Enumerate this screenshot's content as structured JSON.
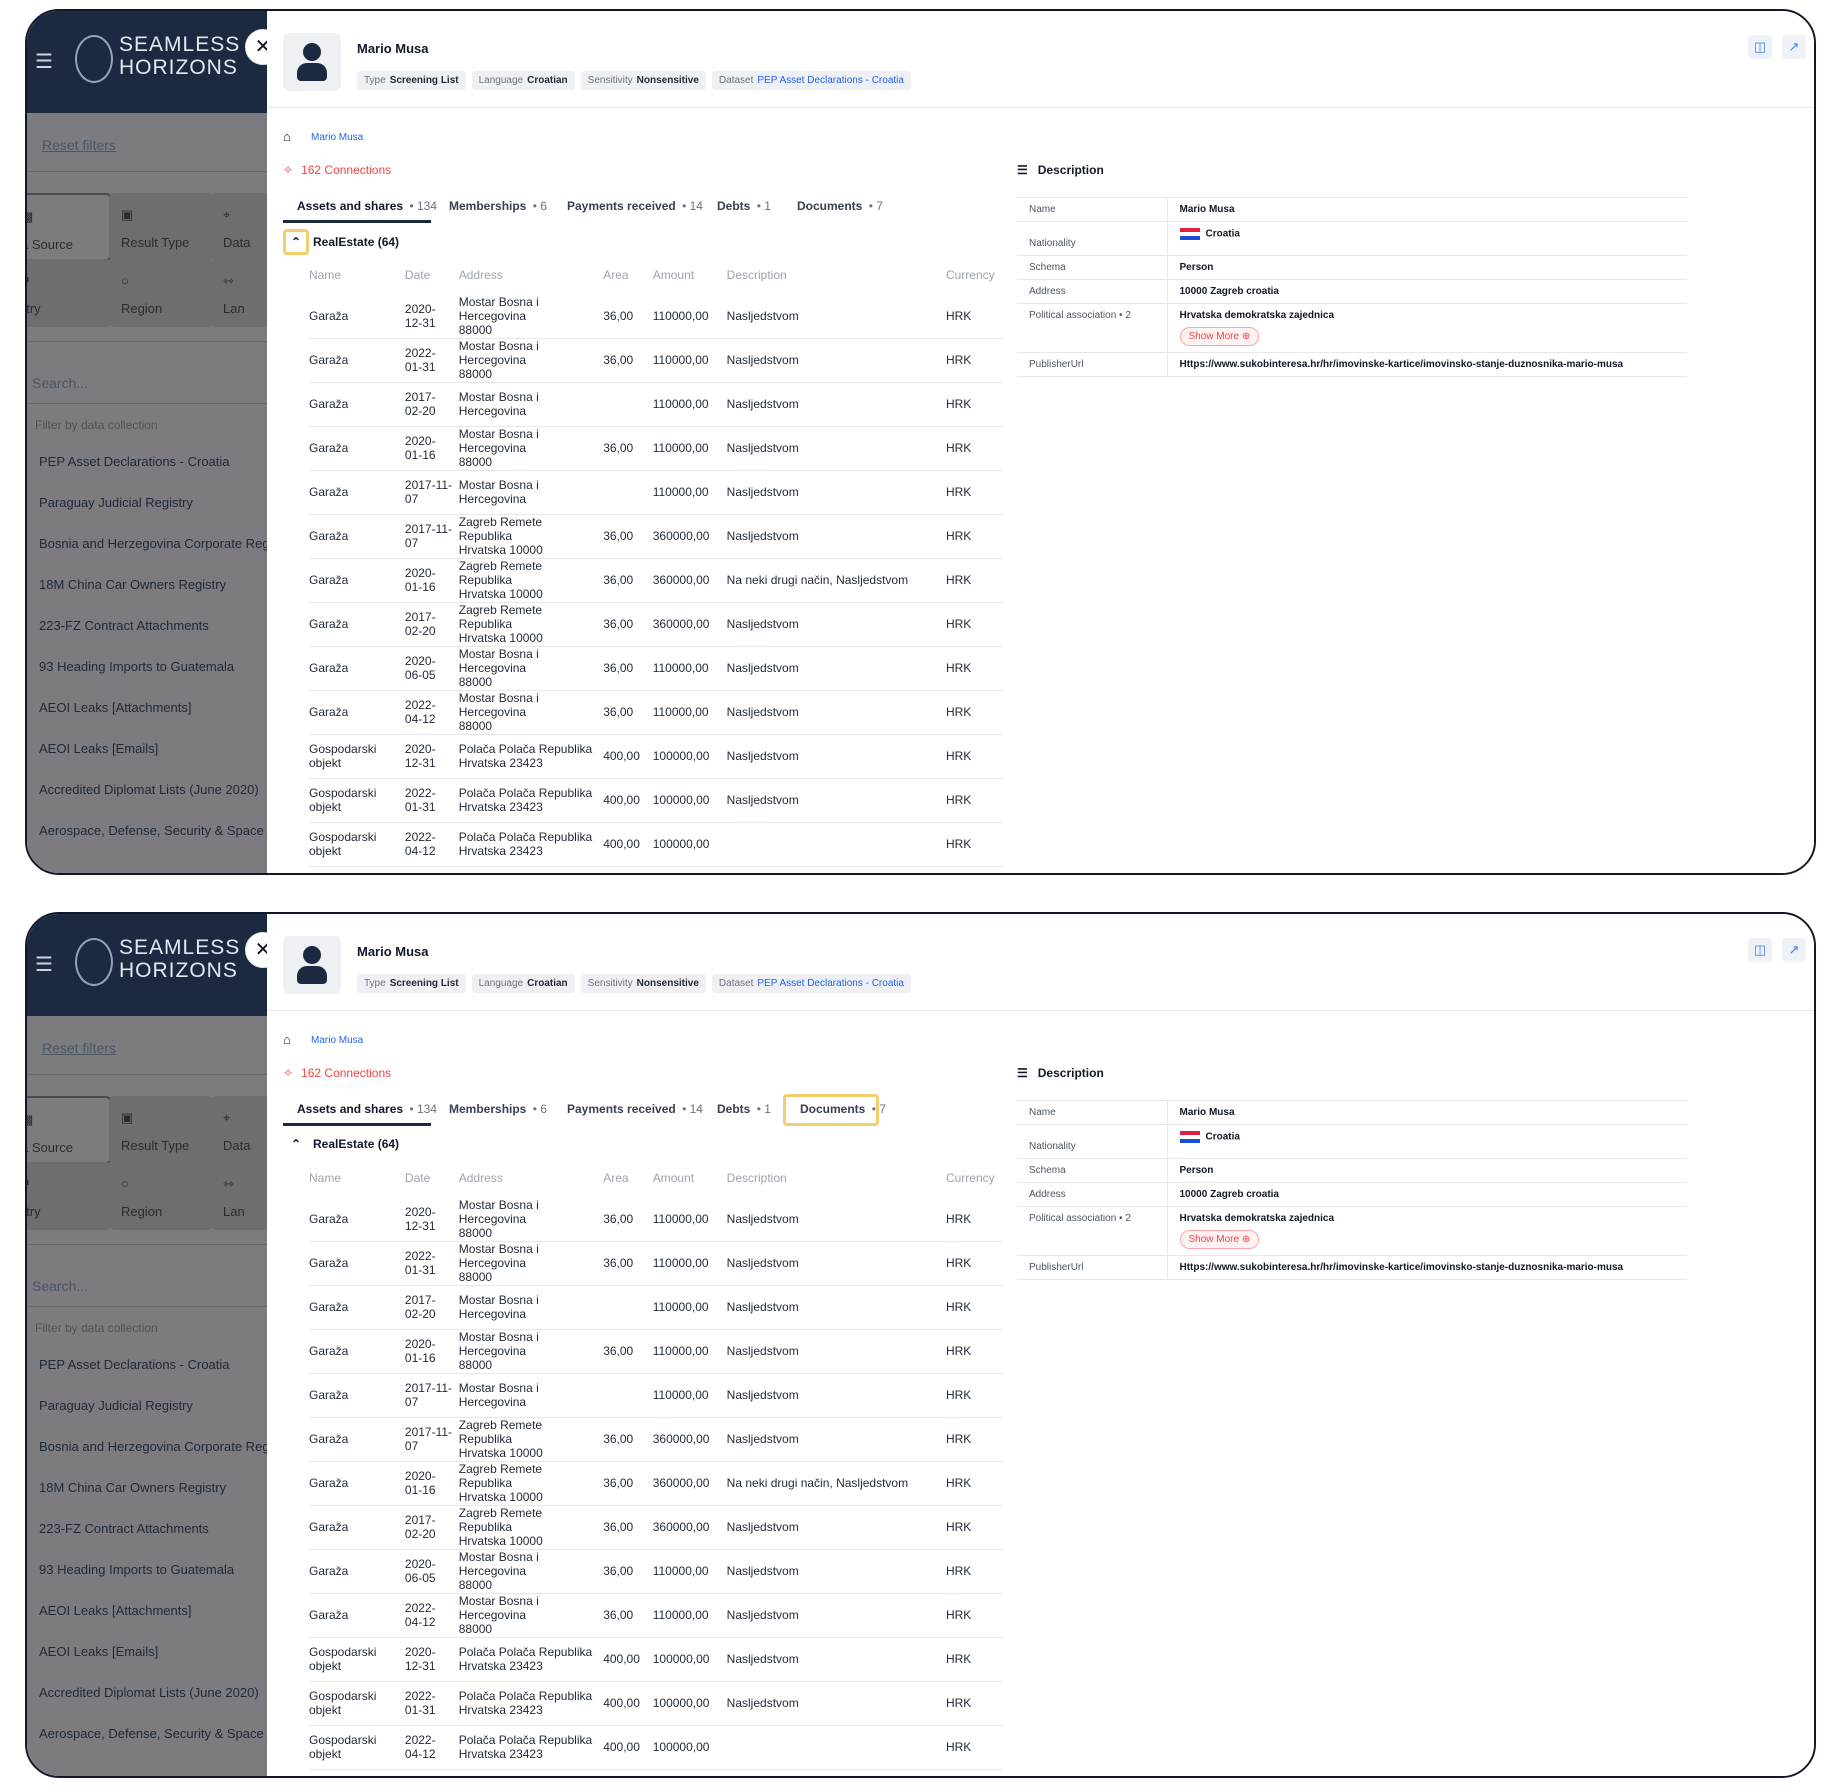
{
  "background_app": {
    "logo_text": "SEAMLESS\nHORIZONS",
    "reset_filters": "Reset filters",
    "tiles": [
      {
        "label": "a Source",
        "icon": "database-icon"
      },
      {
        "label": "Result Type",
        "icon": "bookmark-icon"
      },
      {
        "label": "Data",
        "icon": "grid-icon"
      },
      {
        "label": "ntry",
        "icon": "flag-icon"
      },
      {
        "label": "Region",
        "icon": "globe-icon"
      },
      {
        "label": "Lan",
        "icon": "translate-icon"
      }
    ],
    "search_placeholder": "Search...",
    "filter_placeholder": "Filter by data collection",
    "collections": [
      "PEP Asset Declarations - Croatia",
      "Paraguay Judicial Registry",
      "Bosnia and Herzegovina Corporate Regi",
      "18M China Car Owners Registry",
      "223-FZ Contract Attachments",
      "93 Heading Imports to Guatemala",
      "AEOI Leaks [Attachments]",
      "AEOI Leaks [Emails]",
      "Accredited Diplomat Lists (June 2020)",
      "Aerospace, Defense, Security & Space A"
    ]
  },
  "drawer": {
    "name": "Mario Musa",
    "chips": [
      {
        "label": "Type",
        "value": "Screening List"
      },
      {
        "label": "Language",
        "value": "Croatian"
      },
      {
        "label": "Sensitivity",
        "value": "Nonsensitive"
      },
      {
        "label": "Dataset",
        "value": "PEP Asset Declarations - Croatia"
      }
    ],
    "breadcrumb": "Mario Musa",
    "connections": "162 Connections",
    "tabs": [
      {
        "label": "Assets and shares",
        "count": "134"
      },
      {
        "label": "Memberships",
        "count": "6"
      },
      {
        "label": "Payments received",
        "count": "14"
      },
      {
        "label": "Debts",
        "count": "1"
      },
      {
        "label": "Documents",
        "count": "7"
      }
    ],
    "section": "RealEstate (64)",
    "columns": [
      "Name",
      "Date",
      "Address",
      "Area",
      "Amount",
      "Description",
      "Currency"
    ],
    "rows": [
      [
        "Garaža",
        "2020-\n12-31",
        "Mostar Bosna i Hercegovina\n88000",
        "36,00",
        "110000,00",
        "Nasljedstvom",
        "HRK"
      ],
      [
        "Garaža",
        "2022-\n01-31",
        "Mostar Bosna i Hercegovina\n88000",
        "36,00",
        "110000,00",
        "Nasljedstvom",
        "HRK"
      ],
      [
        "Garaža",
        "2017-\n02-20",
        "Mostar Bosna i Hercegovina",
        "",
        "110000,00",
        "Nasljedstvom",
        "HRK"
      ],
      [
        "Garaža",
        "2020-\n01-16",
        "Mostar Bosna i Hercegovina\n88000",
        "36,00",
        "110000,00",
        "Nasljedstvom",
        "HRK"
      ],
      [
        "Garaža",
        "2017-11-\n07",
        "Mostar Bosna i Hercegovina",
        "",
        "110000,00",
        "Nasljedstvom",
        "HRK"
      ],
      [
        "Garaža",
        "2017-11-\n07",
        "Zagreb Remete Republika\nHrvatska 10000",
        "36,00",
        "360000,00",
        "Nasljedstvom",
        "HRK"
      ],
      [
        "Garaža",
        "2020-\n01-16",
        "Zagreb Remete Republika\nHrvatska 10000",
        "36,00",
        "360000,00",
        "Na neki drugi način, Nasljedstvom",
        "HRK"
      ],
      [
        "Garaža",
        "2017-\n02-20",
        "Zagreb Remete Republika\nHrvatska 10000",
        "36,00",
        "360000,00",
        "Nasljedstvom",
        "HRK"
      ],
      [
        "Garaža",
        "2020-\n06-05",
        "Mostar Bosna i Hercegovina\n88000",
        "36,00",
        "110000,00",
        "Nasljedstvom",
        "HRK"
      ],
      [
        "Garaža",
        "2022-\n04-12",
        "Mostar Bosna i Hercegovina\n88000",
        "36,00",
        "110000,00",
        "Nasljedstvom",
        "HRK"
      ],
      [
        "Gospodarski\nobjekt",
        "2020-\n12-31",
        "Polača Polača Republika\nHrvatska 23423",
        "400,00",
        "100000,00",
        "Nasljedstvom",
        "HRK"
      ],
      [
        "Gospodarski\nobjekt",
        "2022-\n01-31",
        "Polača Polača Republika\nHrvatska 23423",
        "400,00",
        "100000,00",
        "Nasljedstvom",
        "HRK"
      ],
      [
        "Gospodarski\nobjekt",
        "2022-\n04-12",
        "Polača Polača Republika\nHrvatska 23423",
        "400,00",
        "100000,00",
        "",
        "HRK"
      ]
    ],
    "description_title": "Description",
    "description": {
      "name_key": "Name",
      "name_val": "Mario Musa",
      "nat_key": "Nationality",
      "nat_val": "Croatia",
      "schema_key": "Schema",
      "schema_val": "Person",
      "addr_key": "Address",
      "addr_val": "10000 Zagreb croatia",
      "pol_key": "Political association • 2",
      "pol_val": "Hrvatska demokratska zajednica",
      "show_more": "Show More",
      "pub_key": "PublisherUrl",
      "pub_val": "Https://www.sukobinteresa.hr/hr/imovinske-kartice/imovinsko-stanje-duznosnika-mario-musa"
    }
  },
  "colors": {
    "highlight": "#f4cd6c",
    "navy": "#1b2a41",
    "link": "#2563eb",
    "danger": "#ef4444"
  }
}
